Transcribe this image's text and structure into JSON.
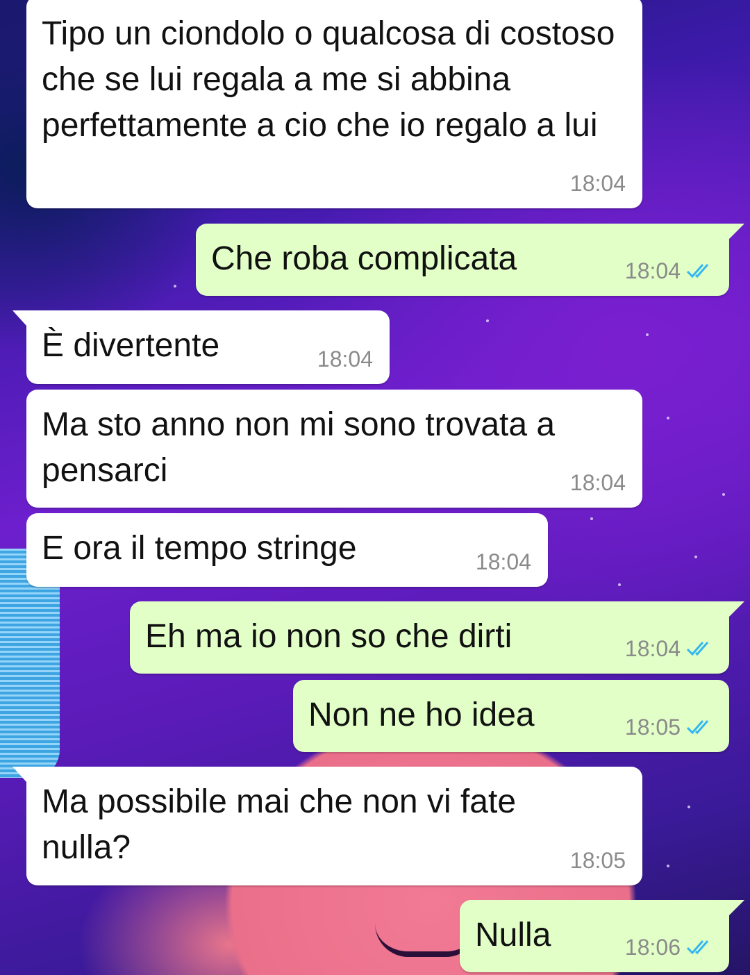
{
  "colors": {
    "incoming_bubble": "#ffffff",
    "outgoing_bubble": "#e1ffc7",
    "read_ticks": "#34b7f1",
    "timestamp": "#8a8a8a"
  },
  "messages": [
    {
      "direction": "incoming",
      "text": "Tipo un ciondolo o qualcosa di costoso che se lui regala a me si abbina perfettamente a cio che io regalo a lui",
      "time": "18:04"
    },
    {
      "direction": "outgoing",
      "text": "Che roba complicata",
      "time": "18:04",
      "status": "read-double-check-icon"
    },
    {
      "direction": "incoming",
      "text": "È divertente",
      "time": "18:04"
    },
    {
      "direction": "incoming",
      "text": "Ma sto anno non mi sono trovata a pensarci",
      "time": "18:04"
    },
    {
      "direction": "incoming",
      "text": "E ora il tempo stringe",
      "time": "18:04"
    },
    {
      "direction": "outgoing",
      "text": "Eh ma io non so che dirti",
      "time": "18:04",
      "status": "read-double-check-icon"
    },
    {
      "direction": "outgoing",
      "text": "Non ne ho idea",
      "time": "18:05",
      "status": "read-double-check-icon"
    },
    {
      "direction": "incoming",
      "text": "Ma possibile mai che non vi fate nulla?",
      "time": "18:05"
    },
    {
      "direction": "outgoing",
      "text": "Nulla",
      "time": "18:06",
      "status": "read-double-check-icon"
    }
  ]
}
